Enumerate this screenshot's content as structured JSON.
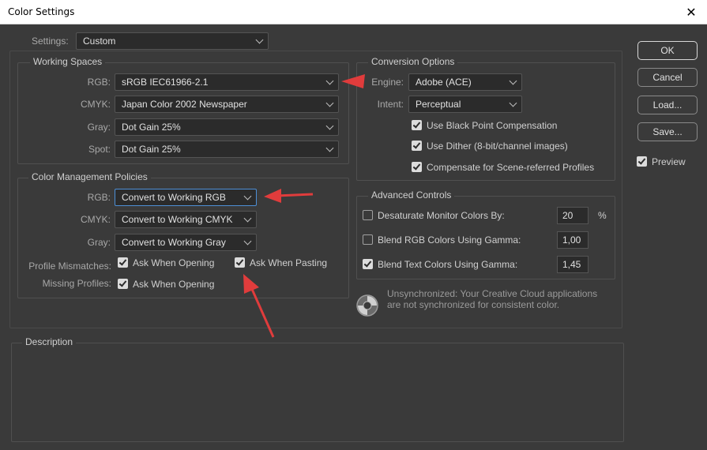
{
  "window": {
    "title": "Color Settings",
    "close_glyph": "✕"
  },
  "settings": {
    "label": "Settings:",
    "value": "Custom"
  },
  "working_spaces": {
    "legend": "Working Spaces",
    "rgb": {
      "label": "RGB:",
      "value": "sRGB IEC61966-2.1"
    },
    "cmyk": {
      "label": "CMYK:",
      "value": "Japan Color 2002 Newspaper"
    },
    "gray": {
      "label": "Gray:",
      "value": "Dot Gain 25%"
    },
    "spot": {
      "label": "Spot:",
      "value": "Dot Gain 25%"
    }
  },
  "policies": {
    "legend": "Color Management Policies",
    "rgb": {
      "label": "RGB:",
      "value": "Convert to Working RGB"
    },
    "cmyk": {
      "label": "CMYK:",
      "value": "Convert to Working CMYK"
    },
    "gray": {
      "label": "Gray:",
      "value": "Convert to Working Gray"
    },
    "mismatch_label": "Profile Mismatches:",
    "mismatch_opening": {
      "label": "Ask When Opening",
      "checked": true
    },
    "mismatch_pasting": {
      "label": "Ask When Pasting",
      "checked": true
    },
    "missing_label": "Missing Profiles:",
    "missing_opening": {
      "label": "Ask When Opening",
      "checked": true
    }
  },
  "conversion": {
    "legend": "Conversion Options",
    "engine": {
      "label": "Engine:",
      "value": "Adobe (ACE)"
    },
    "intent": {
      "label": "Intent:",
      "value": "Perceptual"
    },
    "black_point": {
      "label": "Use Black Point Compensation",
      "checked": true
    },
    "dither": {
      "label": "Use Dither (8-bit/channel images)",
      "checked": true
    },
    "scene": {
      "label": "Compensate for Scene-referred Profiles",
      "checked": true
    }
  },
  "advanced": {
    "legend": "Advanced Controls",
    "desaturate": {
      "label": "Desaturate Monitor Colors By:",
      "checked": false,
      "value": "20",
      "unit": "%"
    },
    "blend_rgb": {
      "label": "Blend RGB Colors Using Gamma:",
      "checked": false,
      "value": "1,00"
    },
    "blend_text": {
      "label": "Blend Text Colors Using Gamma:",
      "checked": true,
      "value": "1,45"
    }
  },
  "sync_note": {
    "line1": "Unsynchronized: Your Creative Cloud applications",
    "line2": "are not synchronized for consistent color."
  },
  "description": {
    "legend": "Description"
  },
  "buttons": {
    "ok": "OK",
    "cancel": "Cancel",
    "load": "Load...",
    "save": "Save..."
  },
  "preview": {
    "label": "Preview",
    "checked": true
  },
  "colors": {
    "background": "#3a3a3a",
    "field": "#2b2b2b",
    "focus": "#4d8fd6",
    "annotation_arrow": "#e03c3c"
  },
  "icons": {
    "sync": "sync-status-icon",
    "arrow": "annotation-arrow"
  }
}
